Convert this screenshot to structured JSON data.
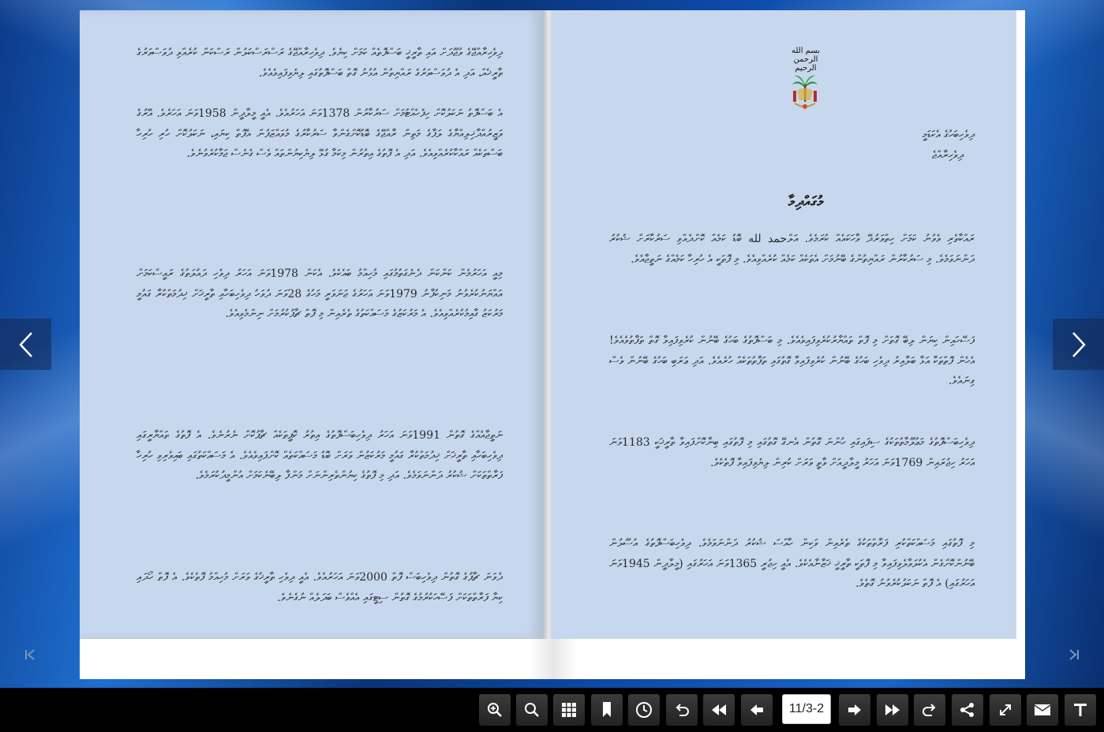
{
  "viewer": {
    "page_indicator": "11/3-2"
  },
  "left_page": {
    "paragraphs": [
      "ދިވެހިރާއްޖޭގެ ވުޖޫދަށް އައި ތާރީޚީ ބަސްފޮތެއް ކަމަށް ކިޔެވެ. ދިވެހިރާއްޖޭގެ ރަސްރަސްކަލުން ރަސްކަން ކުރެއްވި ދުވަސްވަރުގެ ތާރީޚެއް، އަދި އެ ދުވަސްވަރުގެ ރައްޔިތުން އުޅުނު ގޮތް ބަސްފޮތުގައި ލިޔެވިފައިވެއެވެ.",
      "އެ ބަސްފޮތު ނަކަލުކޮށް ހިފެހެއްޓުމަށް ސަރުކާރުން 1378ވަނަ އަހަރުއެވެ. އެއީ މީލާދީން 1958ވަނަ އަހަރެވެ. އޭރުގެ ވަޒީރުއްދާޚިލިއްޔާގެ ލަފާގެ މަތިން ރާއްޖޭގެ ބޮޑުކޮށްގެންވާ ސަރުކާރުގެ މުވައްޒަފުން އެފޮތް ކިޔައި، ނަކަލުކޮށް ހުރި ހުރިހާ ބަސްތަކެއް ރައްކާކުރެއްވިއެވެ. އަދި އެ ފޮތުގެ އިތުރުން މިކަމާ ގުޅޭ ލިޔެކިޔުންތައް ވެސް ގެނެސް ޖަމާކުރެވުނެވެ.",
      "މިއީ އަހަރުމެން ކަންކަން ދެނެގަތުމުގައި މުހިއްމު ބައެކެވެ. އެކަން 1978ވަނަ އަހަރު ދިވެހި ދައުލަތުގެ ރައީސްކަމަށް އައްޔަނުކުރެވުނު މަނިކުފާނު 1979ވަނަ އަހަރުގެ ޖަނަވަރީ މަހުގެ 28ވަނަ ދުވަހު ދިވެހިބަހާއި ތާރީޚަށް ޚިދުމަތްކުރާ ގައުމީ މަރުކަޒު ގާއިމުކުރެއްވިއެވެ. އެ މަރުކަޒުގެ މަސައްކަތުގެ ތެރެއިން މި ފޮތް ޗާޕުކުރުމަށް ނިންމެވިއެވެ.",
      "ނަތީޖާއެއްގެ ގޮތުން 1991ވަނަ އަހަރު ދިވެހިބަސްފޮތުގެ އިތުރު ކޮޕީތަކެއް ޗާޕުކޮށް ނެރުނެވެ. އެ ފޮތުގެ ތައްޔާރީގައި ދިވެހިބަހާއި ތާރީޚަށް ޚިދުމަތްކުރާ ގައުމީ މަރުކަޒުން ވަރަށް ބޮޑު މަސައްކަތެއް ކޮށްފައިވެއެވެ. އެ މަސައްކަތުގައި ބައިވެރިވި ހުރިހާ ފަރާތްތަކަށް ޝުކުރު ދަންނަވަމެވެ. އަދި މި ފޮތުގެ ކިޔުންތެރިންނަށް މަންފާ ލިބޭނެކަމަށް އުންމީދުކުރަމެވެ.",
      "ދެވަނަ ޗާޕުގެ ގޮތުން ދިވެހިބަސް ފޮތް 2000ވަނަ އަހަރުއެވެ. އެއީ ދިވެހި ތާރީޚުގެ ވަރަށް މުހިއްމު ފޮތެކެވެ. އެ ފޮތް ހޯދައި ކިޔާ ފަރާތްތަކަށް ފަސޭހަކުރުމުގެ ގޮތުން ސިޓީގައި އެއްވެސް ބަދަލެއް ނުގެނެވެ."
    ]
  },
  "right_page": {
    "bismillah": "بسم الله الرحمن الرحيم",
    "address": [
      "ދިވެހިބަހުގެ އެކަޑަމީ",
      "ދިވެހިރާއްޖެ"
    ],
    "title": "މުގައްދިމާ",
    "paragraphs": [
      "ރައްކާތެރި ވެވުނު ކަމަށް ހިތްވަރުދޭ ވާހަކައެއް ކުރަމެވެ. އަލްحمد لله ބޮޑު ކަމެއް ކޮށްދެއްވި ސަރުކާރަށް ޝުކުރު ދަންނަވަމެވެ. މި ސަރުކާރުން ރައްޔިތުންގެ ބޭނުމަށް އެތަކެއް ކަމެއް ކުރެއްވިއެވެ. މި ފޮތަކީ އެ ހުރިހާ ކަމެއްގެ ނަތީޖާއެވެ.",
      "ފަސޭހައިން ކިޔަން ލިބޭ ގޮތަށް މި ފޮތް ތައްޔާރުކުރެވިފައިވެއެވެ. މި ބަސްފޮތުގެ ބަހުގެ ބޭނުން ކުރެވިފައިވާ ގޮތް ތަފާތުވެއެވެ! އެހެން ފޮތްތަކާ އަޅާ ބަލާއިރު ދިވެހި ބަހުގެ ބޭނުން ކުރެވިފައިވާ ގޮތުގައި ތަފާތުތަކެއް ހުރެއެވެ. އަދި ޢަރަބި ބަހުގެ ބޭނުން ވެސް ގިނައެވެ.",
      "ދިވެހިބަސްފޮތުގެ މަޢުލޫމާތުތަކުގެ ސިފައިގައި ހުންނަ ގޮތުން އެނގޭ ގޮތުގައި މި ފޮތުގައި ބިނާކޮށްފައިވާ ތާރީޚަކީ 1183ވަނަ އަހަރު ހިޖުރައިން 1769ވަނަ އަހަރު މީލާދީއަށް ވާތީ ވަރަށް ކުރިން ލިޔެވިފައިވާ ފޮތެކެވެ.",
      "މި ފޮތުގައި މަސައްކަތްކުރި ފަރާތްތަކުގެ ތެރެއިން ވަކިން ހާއްސަ ޝުކުރު ދަންނަވަމެވެ. ދިވެހިބަސްފޮތުގެ އުސޫލުން ބޭނުންކޮށްގެން އެކުލަވާލެވިފައިވާ މި ފޮތަކީ ތާރީޚީ ޚަޒާނާއެކެވެ. އެއީ ހިޖުރީ 1365ވަނަ އަހަރުގައި (މީލާދީން 1945ވަނަ އަހަރުގައި) އެ ފޮތް ނަކަލުކުރެވުނު ގޮތެވެ."
    ]
  },
  "toolbar": {
    "buttons": [
      "zoom-in-icon",
      "zoom-out-icon",
      "thumbnails-icon",
      "bookmark-icon",
      "autoplay-icon",
      "undo-icon",
      "first-page-icon",
      "previous-page-icon",
      "next-page-icon",
      "last-page-icon",
      "redo-icon",
      "share-icon",
      "fullscreen-icon",
      "email-icon",
      "text-icon"
    ]
  }
}
